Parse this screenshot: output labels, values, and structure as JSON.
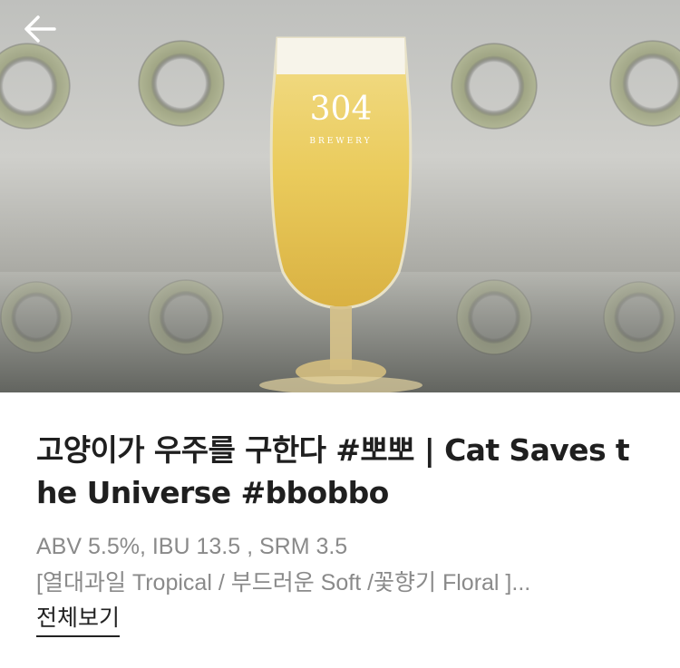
{
  "hero": {
    "image_alt": "304 Brewery beer glass",
    "glass_logo_number": "304",
    "glass_logo_text": "BREWERY"
  },
  "nav": {
    "back_icon": "arrow-left-icon"
  },
  "beer": {
    "title": "고양이가 우주를 구한다 #뽀뽀 | Cat Saves the Universe #bbobbo",
    "specs": "ABV 5.5%, IBU 13.5 , SRM 3.5",
    "description": "[열대과일 Tropical / 부드러운 Soft /꽃향기 Floral ]...",
    "more_label": "전체보기"
  }
}
